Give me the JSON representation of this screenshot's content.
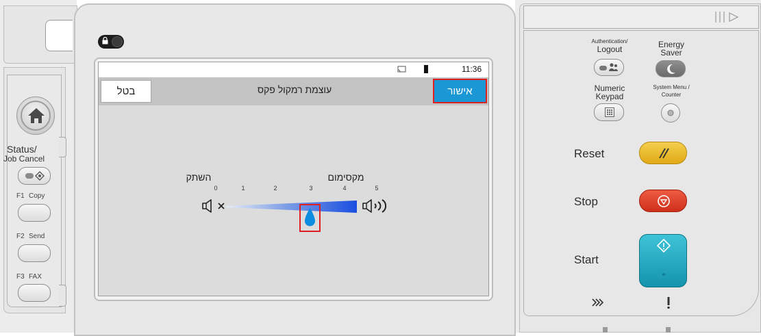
{
  "left_panel": {
    "status_label_line1": "Status/",
    "status_label_line2": "Job Cancel",
    "f1_key": "F1",
    "f1_label": "Copy",
    "f2_key": "F2",
    "f2_label": "Send",
    "f3_key": "F3",
    "f3_label": "FAX"
  },
  "screen": {
    "time": "11:36",
    "title": "עוצמת רמקול פקס",
    "cancel_label": "בטל",
    "ok_label": "אישור",
    "volume": {
      "mute_label": "השתק",
      "max_label": "מקסימום",
      "ticks": [
        "0",
        "1",
        "2",
        "3",
        "4",
        "5"
      ],
      "current_level": 3,
      "min": 0,
      "max": 5
    }
  },
  "right_panel": {
    "auth_label_line1": "Authentication/",
    "auth_label_line2": "Logout",
    "energy_label_line1": "Energy",
    "energy_label_line2": "Saver",
    "numeric_label_line1": "Numeric",
    "numeric_label_line2": "Keypad",
    "sysmenu_label_line1": "System Menu /",
    "sysmenu_label_line2": "Counter",
    "reset_label": "Reset",
    "stop_label": "Stop",
    "start_label": "Start"
  },
  "colors": {
    "ok_button": "#1a97d4",
    "highlight": "#e02020",
    "reset_button": "#f0c030",
    "stop_button": "#e04530",
    "start_button": "#2bb3c9",
    "slider_fill": "#1f57e0"
  },
  "icons": {
    "home": "home-icon",
    "speaker_mute": "speaker-mute-icon",
    "speaker_max": "speaker-max-icon",
    "slider_handle": "droplet-icon",
    "lock": "lock-icon",
    "cast": "cast-icon",
    "battery": "battery-icon"
  }
}
